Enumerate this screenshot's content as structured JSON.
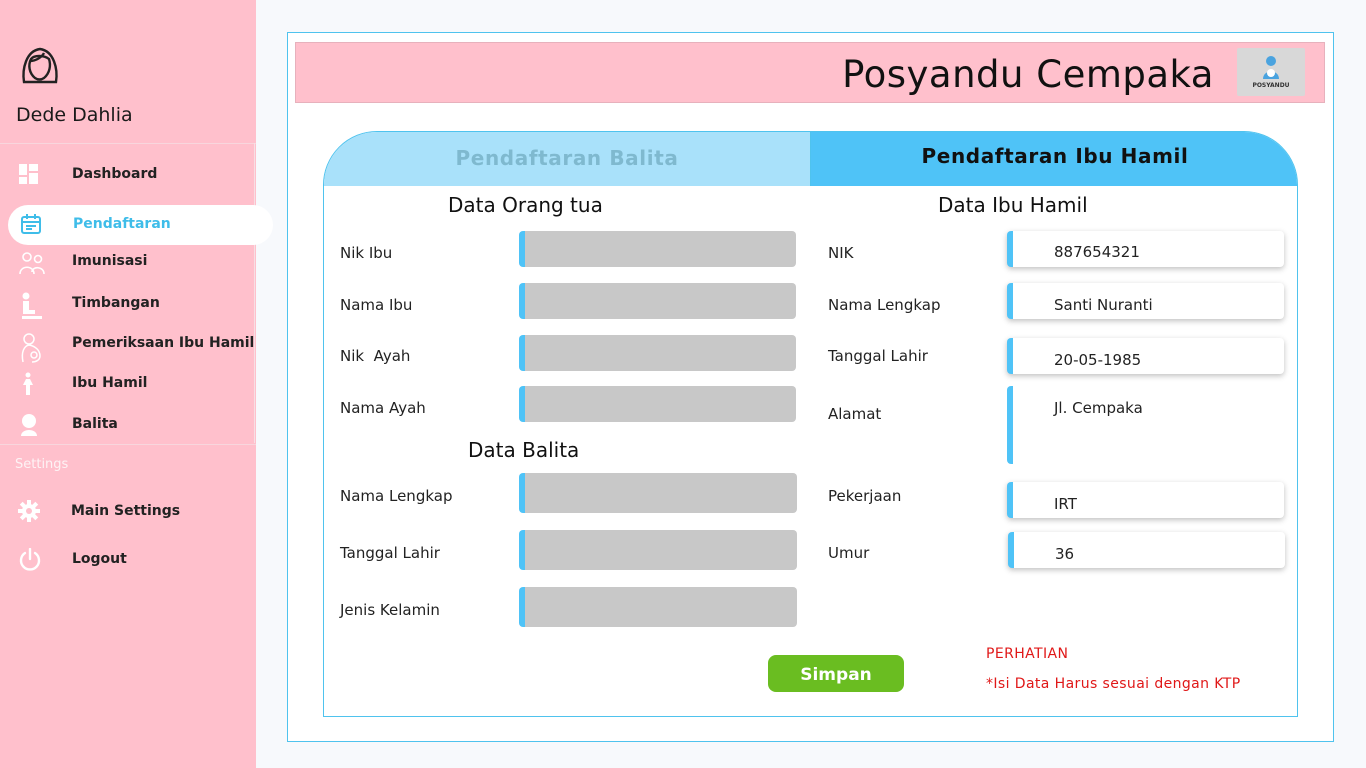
{
  "sidebar": {
    "user_name": "Dede Dahlia",
    "items": [
      {
        "label": "Dashboard",
        "icon": "dashboard-icon"
      },
      {
        "label": "Pendaftaran",
        "icon": "calendar-icon",
        "active": true
      },
      {
        "label": "Imunisasi",
        "icon": "immunization-icon"
      },
      {
        "label": "Timbangan",
        "icon": "scale-icon"
      },
      {
        "label": "Pemeriksaan Ibu Hamil",
        "icon": "mother-checkup-icon"
      },
      {
        "label": "Ibu Hamil",
        "icon": "pregnant-icon"
      },
      {
        "label": "Balita",
        "icon": "baby-icon"
      }
    ],
    "settings_section": "Settings",
    "settings_items": [
      {
        "label": "Main Settings",
        "icon": "gear-icon"
      },
      {
        "label": "Logout",
        "icon": "power-icon"
      }
    ]
  },
  "header": {
    "title": "Posyandu Cempaka",
    "logo_text": "POSYANDU"
  },
  "tabs": [
    {
      "label": "Pendaftaran Balita",
      "active": false
    },
    {
      "label": "Pendaftaran Ibu Hamil",
      "active": true
    }
  ],
  "form_balita": {
    "section_parents": "Data Orang tua",
    "nik_ibu_label": "Nik Ibu",
    "nama_ibu_label": "Nama Ibu",
    "nik_ayah_label": "Nik  Ayah",
    "nama_ayah_label": "Nama Ayah",
    "section_child": "Data Balita",
    "nama_lengkap_label": "Nama Lengkap",
    "tanggal_lahir_label": "Tanggal Lahir",
    "jenis_kelamin_label": "Jenis Kelamin"
  },
  "form_ibu_hamil": {
    "section_title": "Data Ibu Hamil",
    "nik_label": "NIK",
    "nik_value": "887654321",
    "nama_label": "Nama Lengkap",
    "nama_value": "Santi Nuranti",
    "tanggal_label": "Tanggal Lahir",
    "tanggal_value": "20-05-1985",
    "alamat_label": "Alamat",
    "alamat_value": "Jl. Cempaka",
    "pekerjaan_label": "Pekerjaan",
    "pekerjaan_value": "IRT",
    "umur_label": "Umur",
    "umur_value": "36"
  },
  "save_label": "Simpan",
  "notice": {
    "title": "PERHATIAN",
    "text": "*Isi Data Harus sesuai dengan KTP"
  },
  "colors": {
    "sidebar_bg": "#ffc0cc",
    "accent_blue": "#4fc3f7",
    "save_green": "#6abd21",
    "warning_red": "#e01818"
  }
}
